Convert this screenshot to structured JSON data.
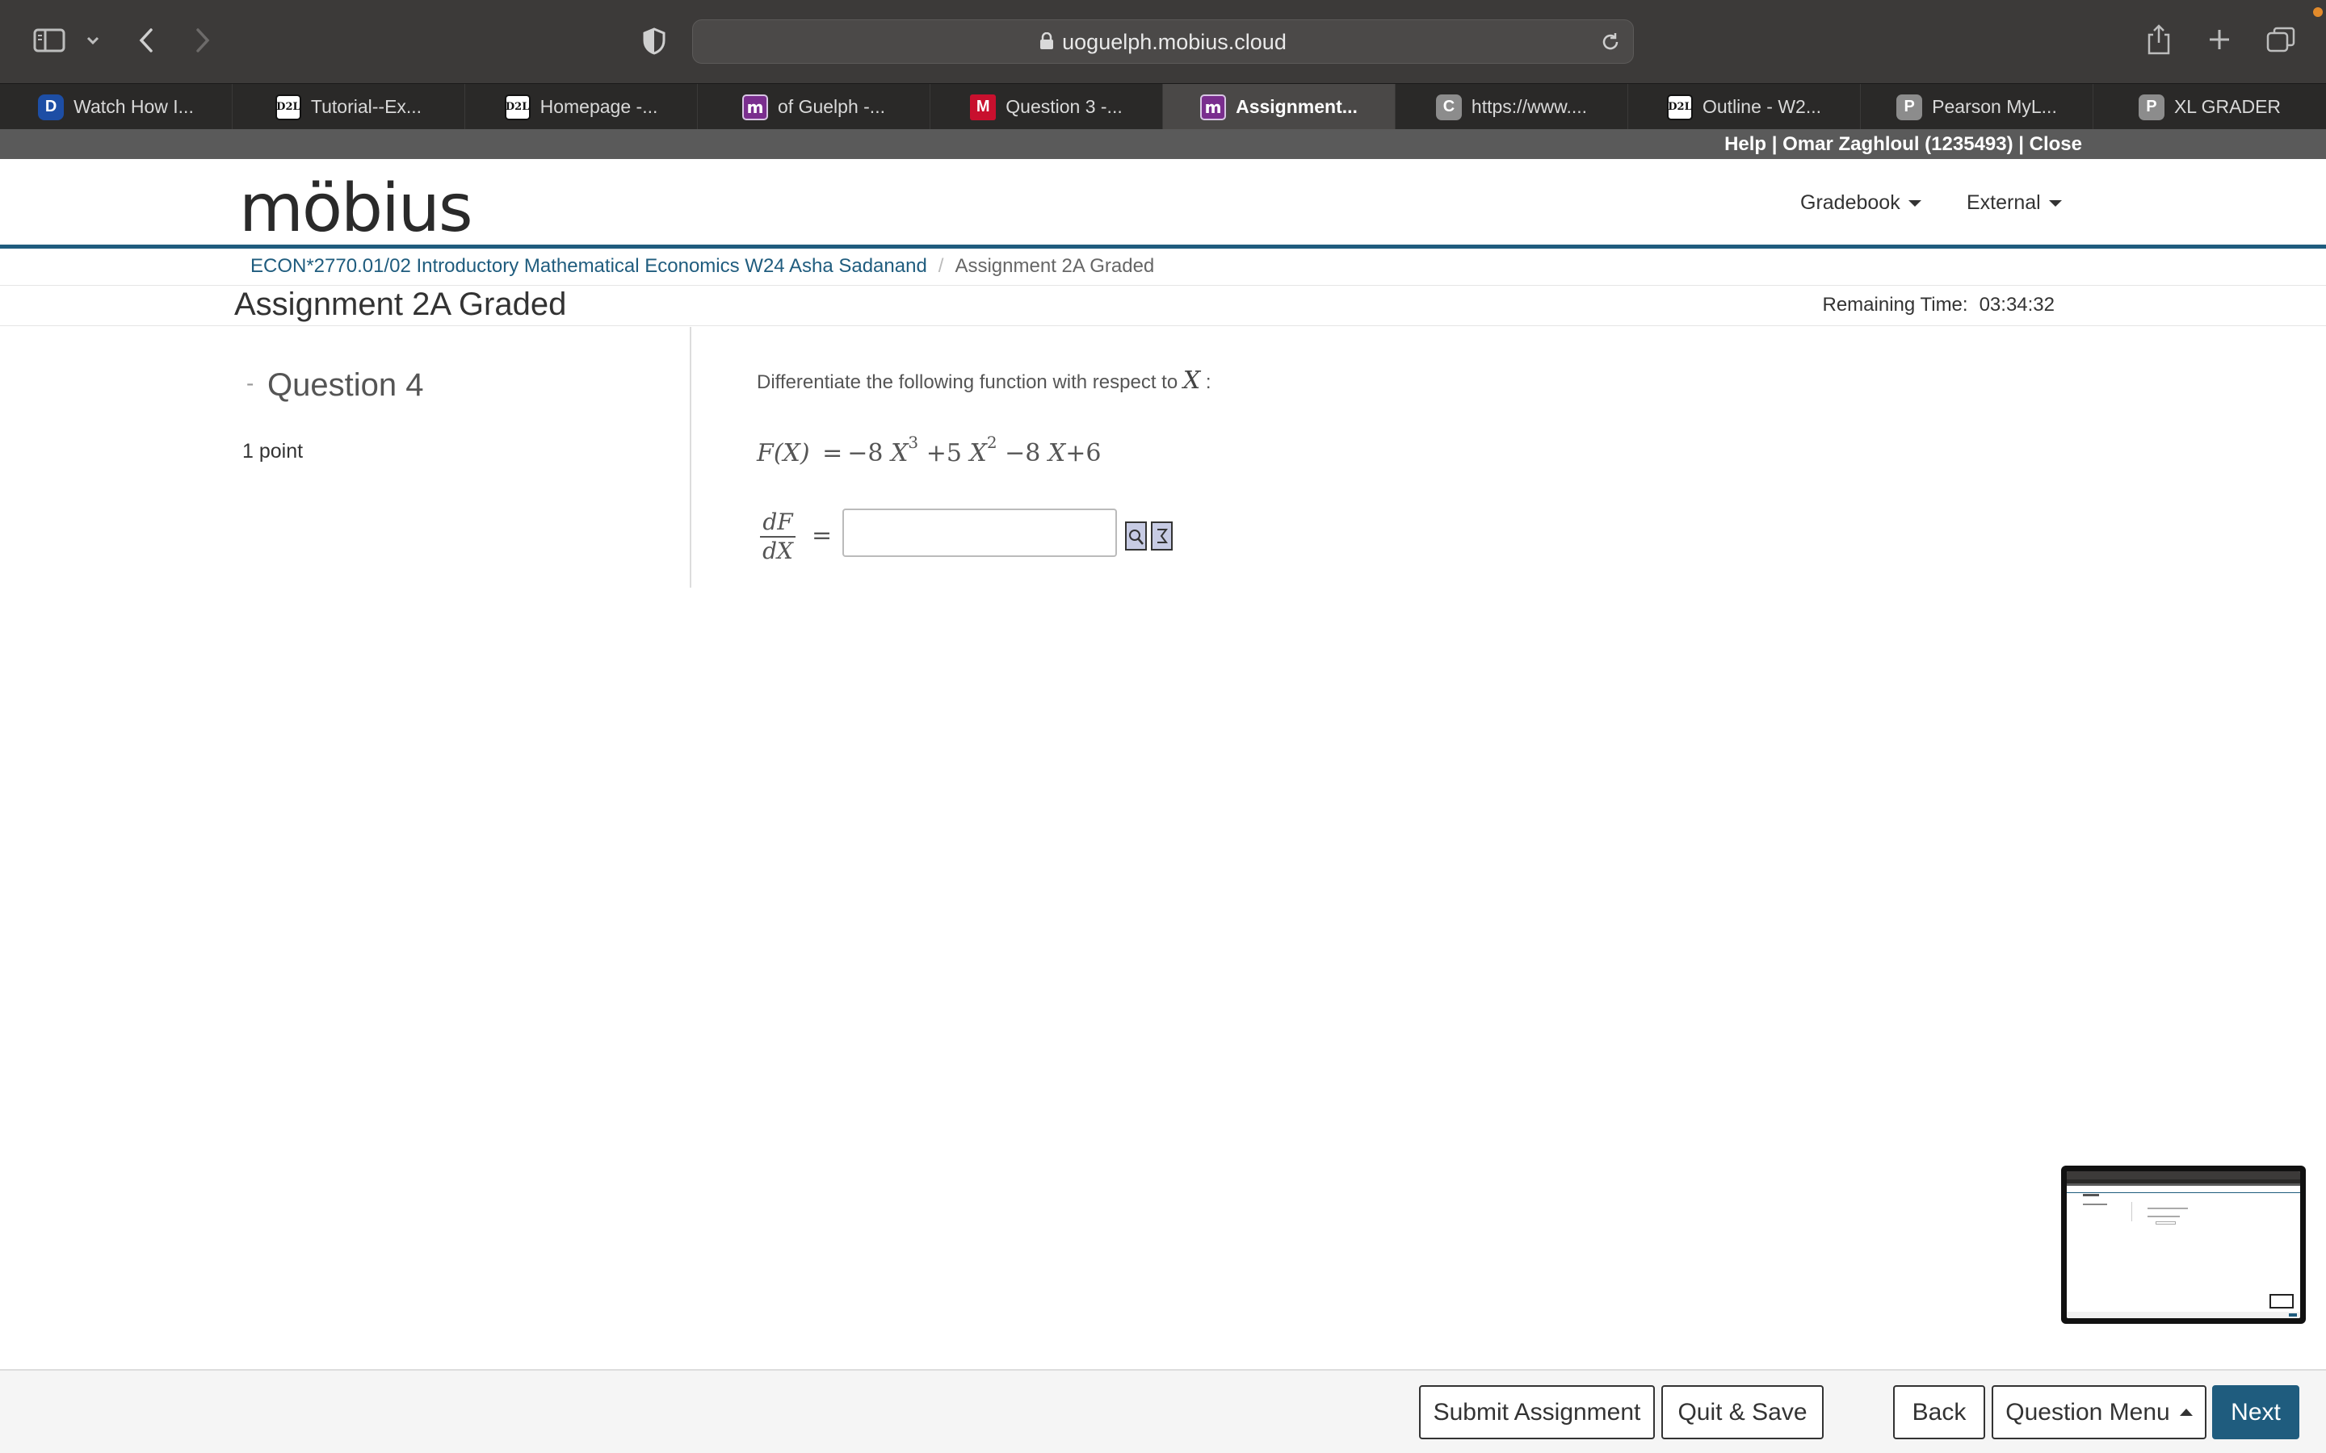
{
  "browser": {
    "url": "uoguelph.mobius.cloud",
    "tabs": [
      {
        "label": "Watch How I...",
        "favicon": "disney-plus-icon",
        "badge": ""
      },
      {
        "label": "Tutorial--Ex...",
        "favicon": "d2l-icon",
        "badge": "D2L"
      },
      {
        "label": "Homepage -...",
        "favicon": "d2l-icon",
        "badge": "D2L"
      },
      {
        "label": "of Guelph -...",
        "favicon": "mobius-icon",
        "badge": "m"
      },
      {
        "label": "Question 3 -...",
        "favicon": "m-red-icon",
        "badge": "M"
      },
      {
        "label": "Assignment...",
        "favicon": "mobius-icon",
        "badge": "m"
      },
      {
        "label": "https://www....",
        "favicon": "c-icon",
        "badge": "C"
      },
      {
        "label": "Outline - W2...",
        "favicon": "d2l-icon",
        "badge": "D2L"
      },
      {
        "label": "Pearson MyL...",
        "favicon": "p-icon",
        "badge": "P"
      },
      {
        "label": "XL GRADER",
        "favicon": "p-icon",
        "badge": "P"
      }
    ],
    "active_tab_index": 5
  },
  "userbar": {
    "help": "Help",
    "sep1": " | ",
    "user": "Omar Zaghloul (1235493)",
    "sep2": " | ",
    "close": "Close"
  },
  "header": {
    "logo": "möbius",
    "menu_gradebook": "Gradebook",
    "menu_external": "External"
  },
  "breadcrumb": {
    "course": "ECON*2770.01/02 Introductory Mathematical Economics W24 Asha Sadanand",
    "separator": "/",
    "current": "Assignment 2A Graded"
  },
  "assignment": {
    "title": "Assignment 2A Graded",
    "remaining_label": "Remaining Time:",
    "remaining_value": "03:34:32"
  },
  "question": {
    "collapse": "-",
    "title": "Question 4",
    "points": "1 point",
    "instruction": "Differentiate the following function with respect to",
    "variable": "X",
    "colon": ":",
    "equation": {
      "lhs": "F",
      "arg": "(X)",
      "eq": "=",
      "t1_coef": "−8",
      "t1_var": "X",
      "t1_exp": "3",
      "op2": "+",
      "t2_coef": "5",
      "t2_var": "X",
      "t2_exp": "2",
      "op3": "−",
      "t3_coef": "8",
      "t3_var": "X",
      "op4": "+",
      "t4": "6"
    },
    "derivative": {
      "numerator": "dF",
      "denominator": "dX",
      "eq": "="
    },
    "answer_value": "",
    "answer_placeholder": ""
  },
  "footer": {
    "submit": "Submit Assignment",
    "quit_save": "Quit & Save",
    "back": "Back",
    "question_menu": "Question Menu",
    "next": "Next"
  },
  "colors": {
    "brand": "#1f5c7e",
    "toolbar": "#3c3a39",
    "userbar": "#5a5a5a"
  }
}
